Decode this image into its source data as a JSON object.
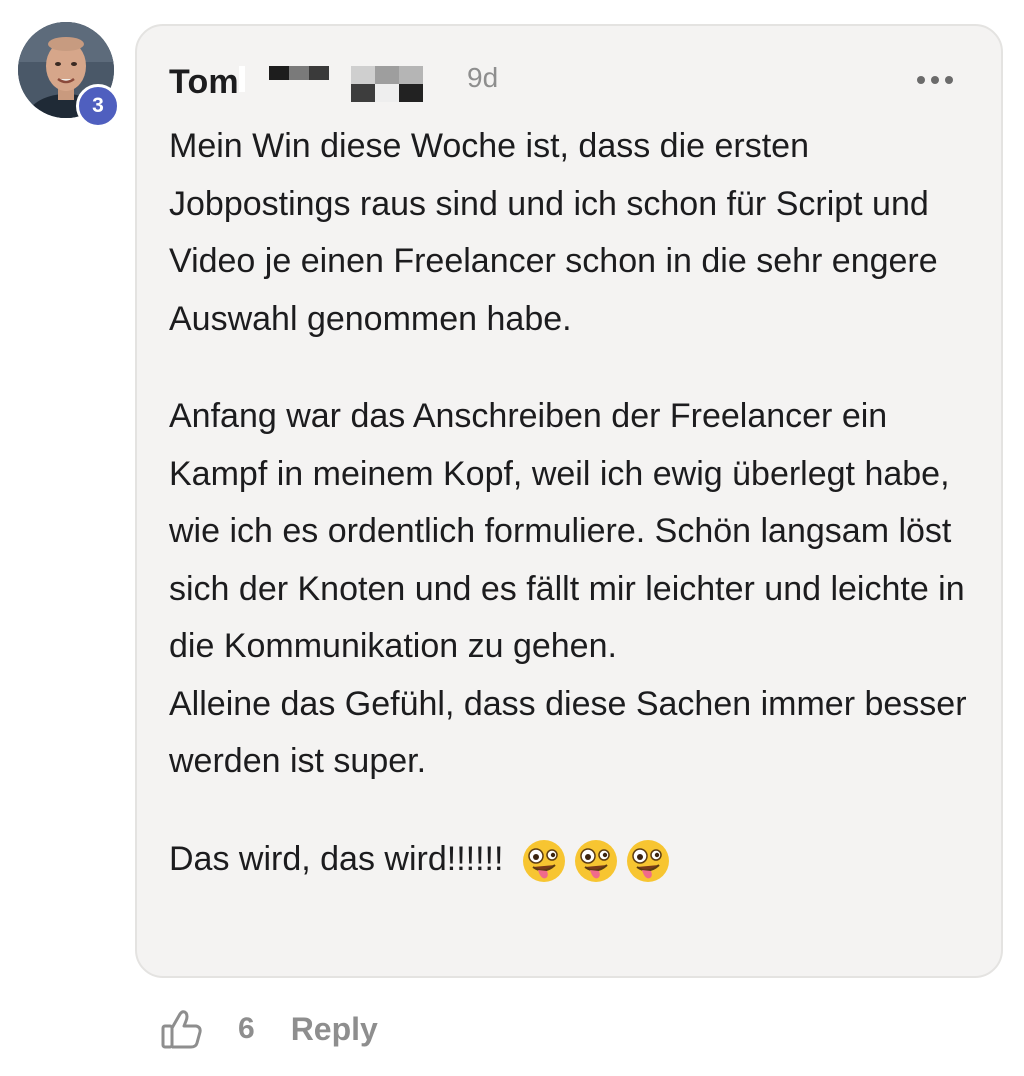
{
  "comment": {
    "author": {
      "name": "Tom",
      "level_badge": "3",
      "avatar": "user-avatar-photo"
    },
    "timestamp": "9d",
    "more_icon": "more-horizontal-icon",
    "body": {
      "paragraph_1": "Mein Win diese Woche ist, dass die ersten Jobpostings raus sind und ich schon für Script und Video je einen Freelancer schon in die sehr engere Auswahl genommen habe.",
      "paragraph_2_line_1": "Anfang war das Anschreiben der Freelancer ein Kampf in meinem Kopf, weil ich ewig überlegt habe, wie ich es ordentlich formuliere. Schön langsam löst sich der Knoten und es fällt mir leichter und leichte in die Kommunikation zu gehen.",
      "paragraph_2_line_2": "Alleine das Gefühl, dass diese Sachen immer besser werden ist super.",
      "paragraph_3": "Das wird, das wird!!!!!!",
      "emojis": [
        "zany-face-emoji",
        "zany-face-emoji",
        "zany-face-emoji"
      ]
    },
    "actions": {
      "like_icon": "thumbs-up-icon",
      "like_count": "6",
      "reply_label": "Reply"
    }
  },
  "colors": {
    "bubble_background": "#f4f3f2",
    "badge": "#4f5fbf",
    "muted_text": "#8e8e8e"
  }
}
